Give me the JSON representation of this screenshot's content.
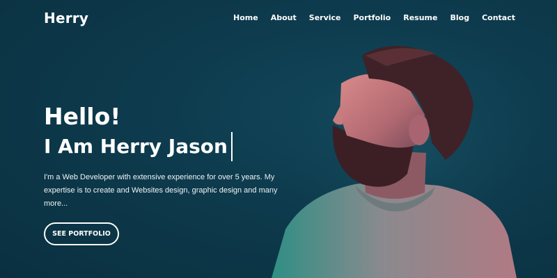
{
  "header": {
    "logo": "Herry",
    "nav": [
      "Home",
      "About",
      "Service",
      "Portfolio",
      "Resume",
      "Blog",
      "Contact"
    ]
  },
  "hero": {
    "greeting": "Hello!",
    "title": "I Am Herry Jason",
    "description": "I'm a Web Developer with extensive experience for over 5 years. My expertise is to create and Websites design, graphic design and many more...",
    "cta_label": "SEE PORTFOLIO"
  },
  "colors": {
    "background": "#0d3a4c",
    "text": "#ffffff"
  }
}
